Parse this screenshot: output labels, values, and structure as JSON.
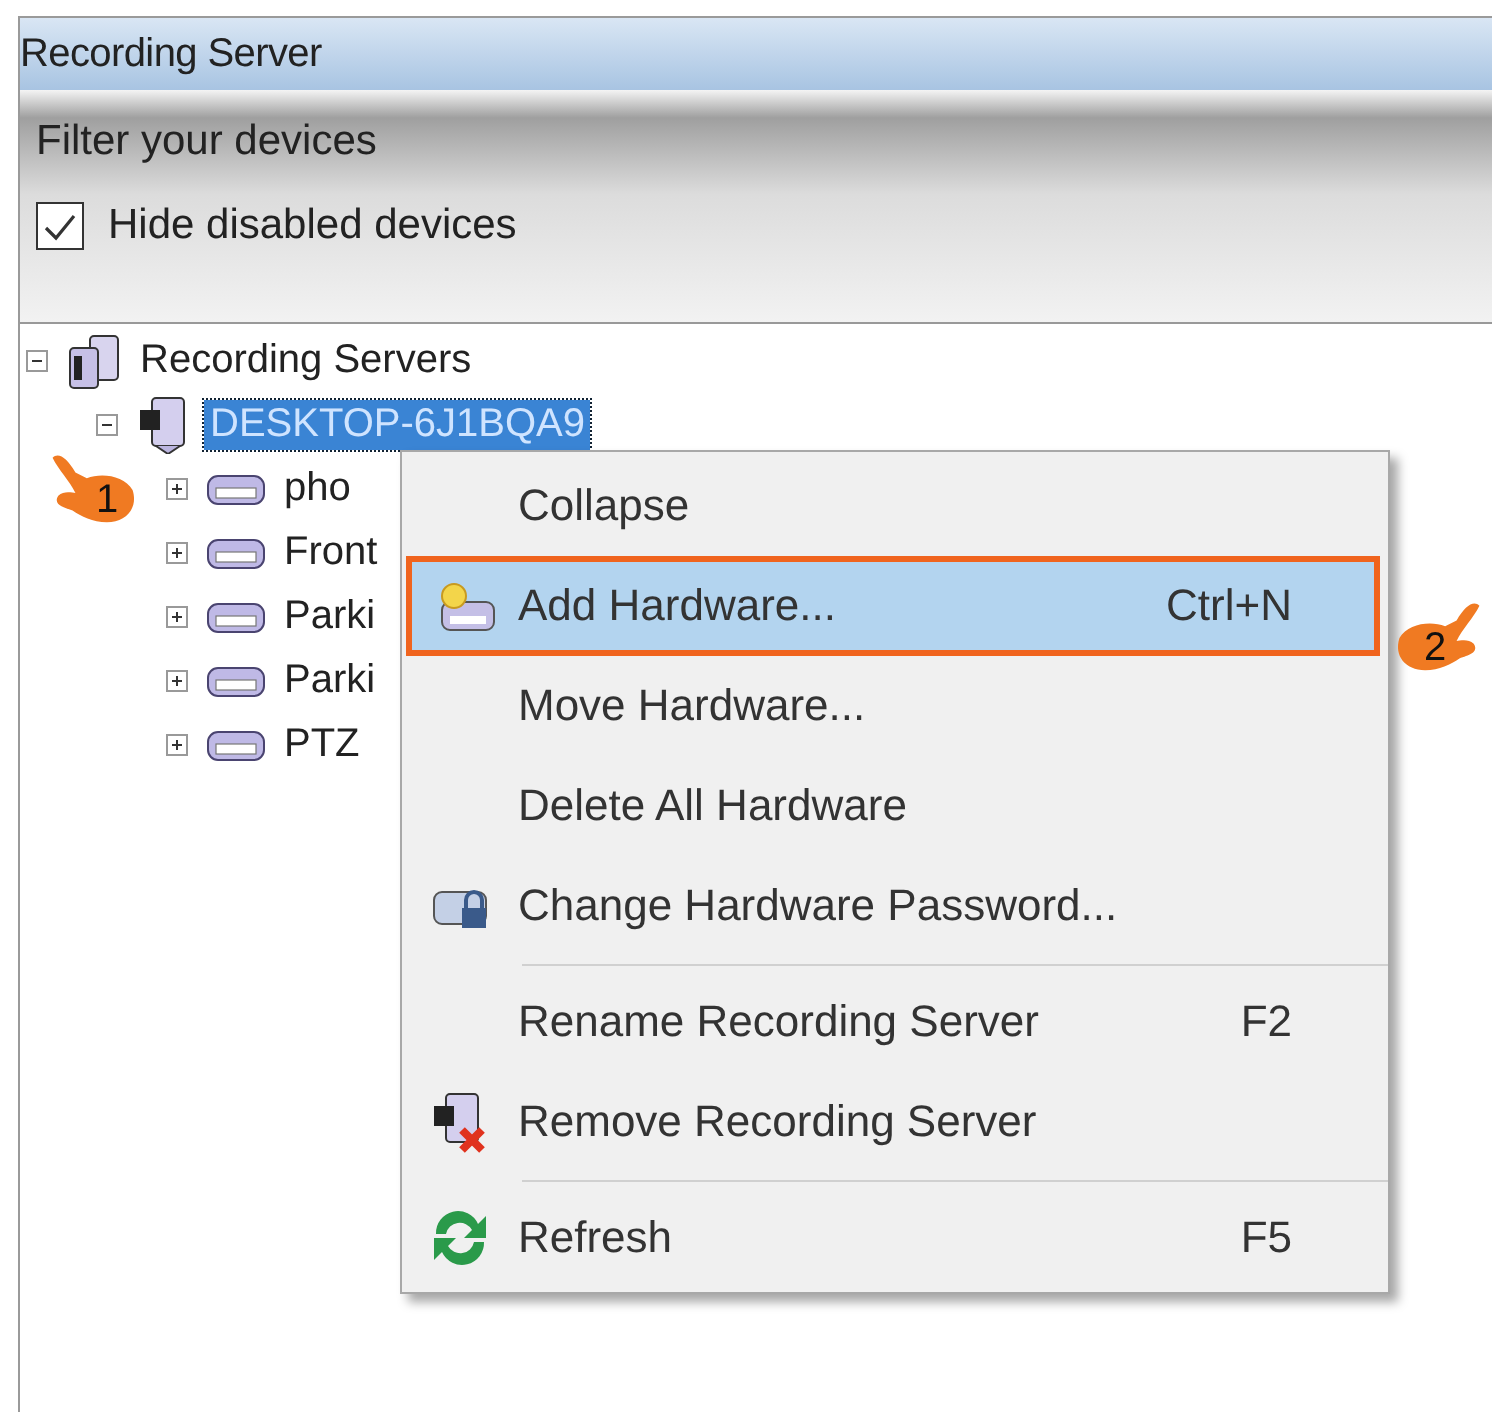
{
  "window": {
    "title": "Recording Server"
  },
  "filter": {
    "heading": "Filter your devices",
    "hide_disabled": {
      "label": "Hide disabled devices",
      "checked": true
    }
  },
  "tree": [
    {
      "label": "Recording Servers",
      "kind": "server-group",
      "expanded": true,
      "selected": false,
      "children": [
        {
          "label": "DESKTOP-6J1BQA9",
          "kind": "server",
          "expanded": true,
          "selected": true,
          "children": [
            {
              "label": "pho",
              "kind": "hardware",
              "expanded": false,
              "selected": false
            },
            {
              "label": "Front",
              "kind": "hardware",
              "expanded": false,
              "selected": false
            },
            {
              "label": "Parki",
              "kind": "hardware",
              "expanded": false,
              "selected": false
            },
            {
              "label": "Parki",
              "kind": "hardware",
              "expanded": false,
              "selected": false
            },
            {
              "label": "PTZ",
              "kind": "hardware",
              "expanded": false,
              "selected": false
            }
          ]
        }
      ]
    }
  ],
  "context_menu": [
    {
      "kind": "plain",
      "label": "Collapse",
      "selected": false
    },
    {
      "kind": "add",
      "label": "Add Hardware...",
      "shortcut": "Ctrl+N",
      "selected": true
    },
    {
      "kind": "plain",
      "label": "Move Hardware...",
      "selected": false
    },
    {
      "kind": "plain",
      "label": "Delete All Hardware",
      "selected": false
    },
    {
      "kind": "lock",
      "label": "Change Hardware Password...",
      "selected": false
    },
    {
      "kind": "separator"
    },
    {
      "kind": "plain",
      "label": "Rename Recording Server",
      "shortcut": "F2",
      "selected": false
    },
    {
      "kind": "remove",
      "label": "Remove Recording Server",
      "selected": false
    },
    {
      "kind": "separator"
    },
    {
      "kind": "refresh",
      "label": "Refresh",
      "shortcut": "F5",
      "selected": false
    }
  ],
  "annotations": [
    {
      "label": "1"
    },
    {
      "label": "2"
    }
  ]
}
